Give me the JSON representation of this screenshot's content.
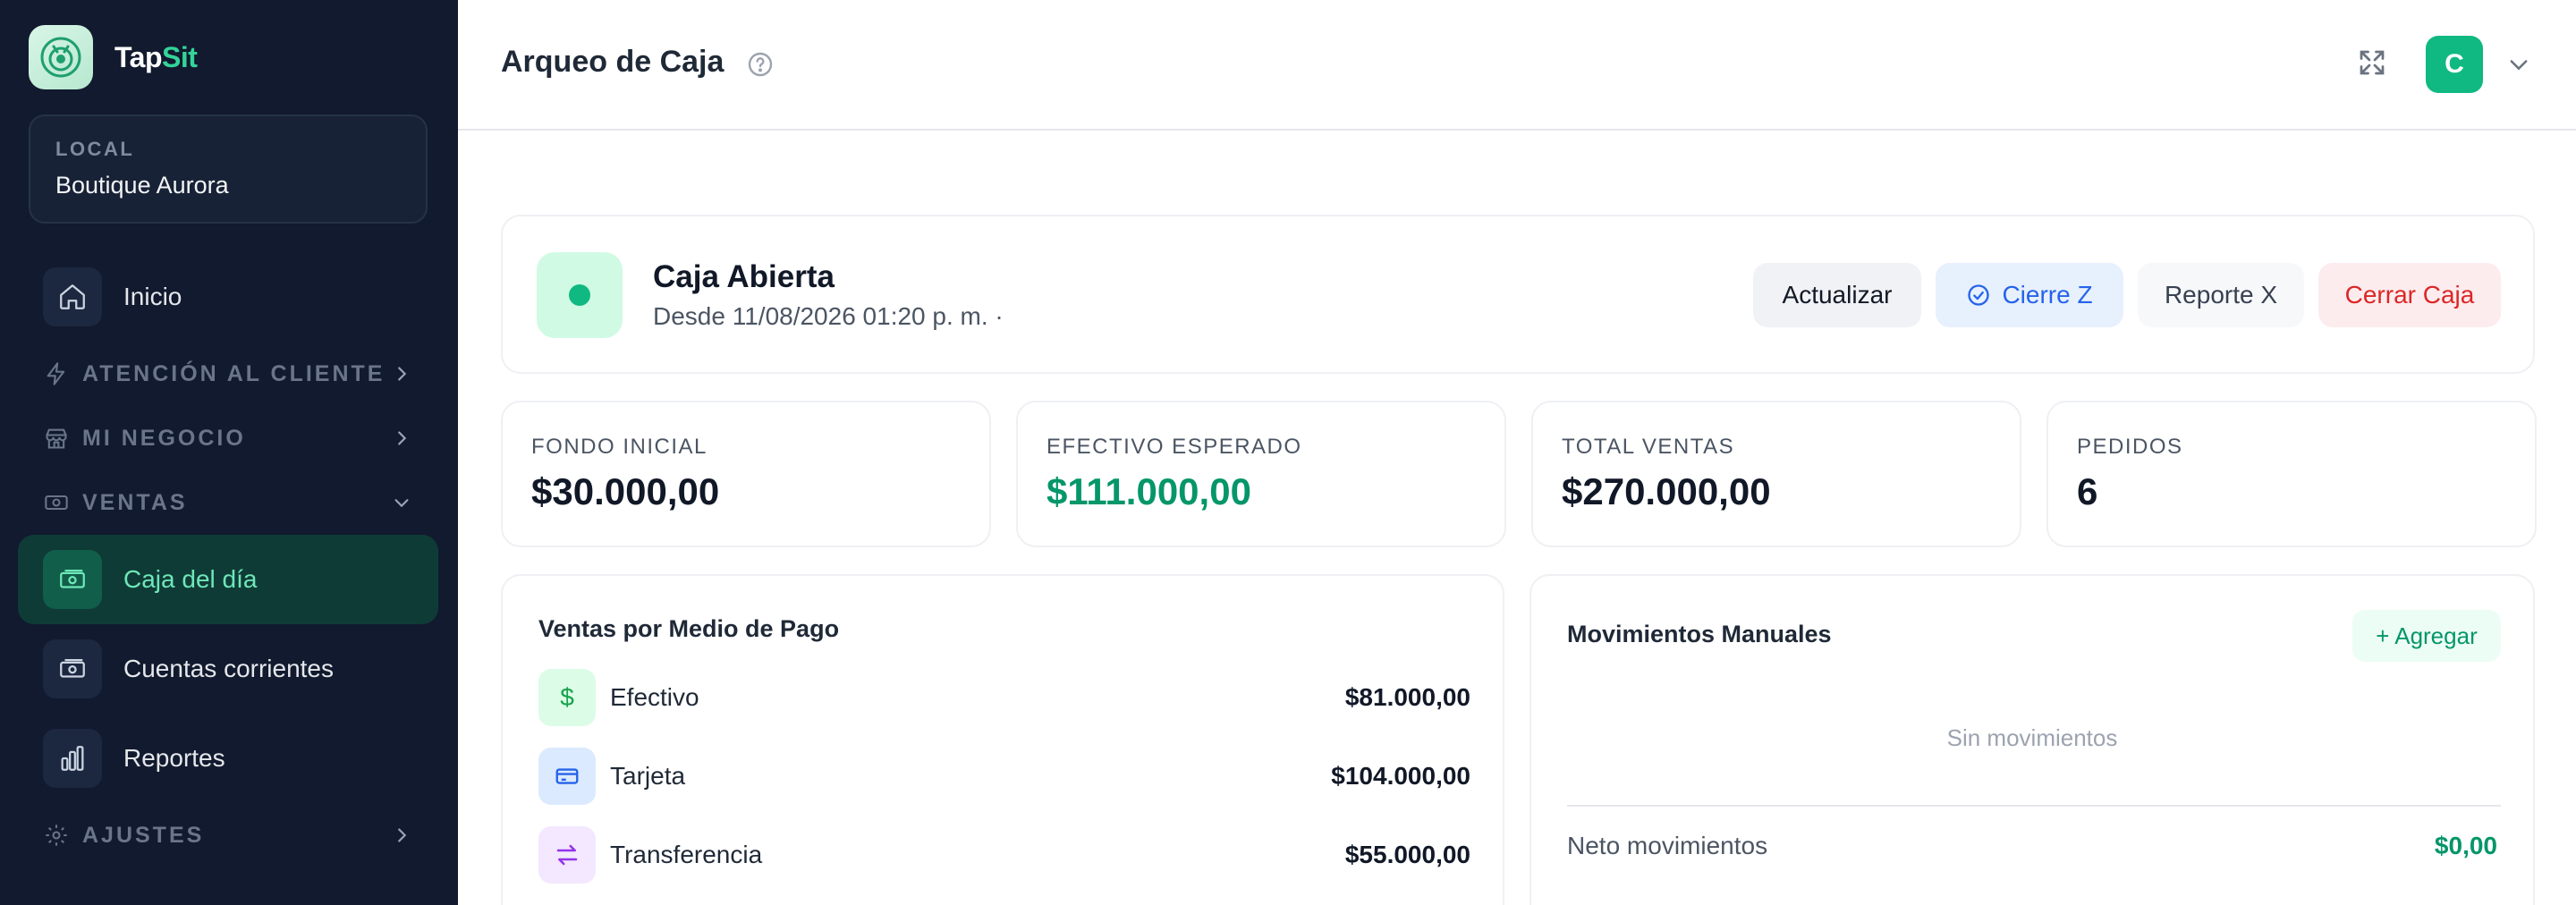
{
  "brand": {
    "name_part1": "Tap",
    "name_part2": "Sit"
  },
  "local": {
    "label": "LOCAL",
    "value": "Boutique Aurora"
  },
  "sidebar": {
    "items": [
      {
        "label": "Inicio",
        "icon": "home-icon"
      },
      {
        "label": "ATENCIÓN AL CLIENTE",
        "icon": "lightning-icon",
        "section": true
      },
      {
        "label": "MI NEGOCIO",
        "icon": "store-icon",
        "section": true
      },
      {
        "label": "VENTAS",
        "icon": "cash-icon",
        "section": true,
        "expanded": true
      },
      {
        "label": "Caja del día",
        "icon": "cash-register-icon",
        "active": true
      },
      {
        "label": "Cuentas corrientes",
        "icon": "banknote-icon"
      },
      {
        "label": "Reportes",
        "icon": "bar-chart-icon"
      },
      {
        "label": "AJUSTES",
        "icon": "gear-icon",
        "section": true
      }
    ]
  },
  "header": {
    "title": "Arqueo de Caja",
    "avatar_letter": "C"
  },
  "status": {
    "title": "Caja Abierta",
    "subtitle": "Desde 11/08/2026 01:20 p. m. ·",
    "buttons": {
      "refresh": "Actualizar",
      "cierre_z": "Cierre Z",
      "reporte_x": "Reporte X",
      "cerrar": "Cerrar Caja"
    }
  },
  "stats": [
    {
      "label": "FONDO INICIAL",
      "value": "$30.000,00",
      "accent": false
    },
    {
      "label": "EFECTIVO ESPERADO",
      "value": "$111.000,00",
      "accent": true
    },
    {
      "label": "TOTAL VENTAS",
      "value": "$270.000,00",
      "accent": false
    },
    {
      "label": "PEDIDOS",
      "value": "6",
      "accent": false
    }
  ],
  "payments": {
    "title": "Ventas por Medio de Pago",
    "rows": [
      {
        "name": "Efectivo",
        "amount": "$81.000,00",
        "icon": "dollar-icon",
        "icon_glyph": "$"
      },
      {
        "name": "Tarjeta",
        "amount": "$104.000,00",
        "icon": "credit-card-icon"
      },
      {
        "name": "Transferencia",
        "amount": "$55.000,00",
        "icon": "transfer-icon"
      }
    ]
  },
  "movements": {
    "title": "Movimientos Manuales",
    "add_label": "+ Agregar",
    "empty_text": "Sin movimientos",
    "net_label": "Neto movimientos",
    "net_value": "$0,00"
  },
  "colors": {
    "sidebar_bg": "#111a2e",
    "accent_green": "#10b981",
    "blue": "#2563eb",
    "red": "#dc2626"
  }
}
